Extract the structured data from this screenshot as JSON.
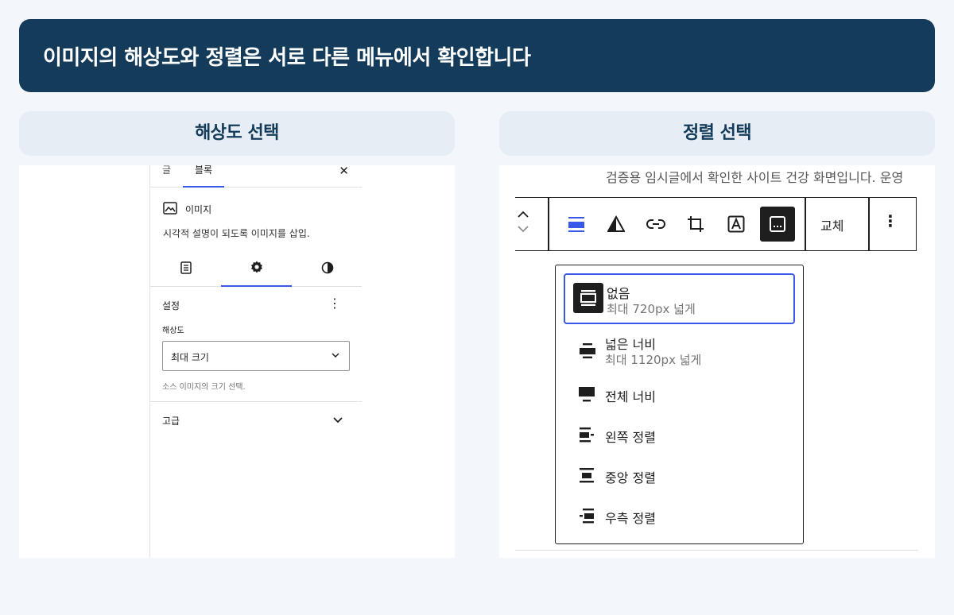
{
  "banner": {
    "title": "이미지의 해상도와 정렬은 서로 다른 메뉴에서 확인합니다"
  },
  "left": {
    "heading": "해상도 선택",
    "tabs": {
      "post": "글",
      "block": "블록",
      "close": "✕"
    },
    "block": {
      "name": "이미지",
      "description": "시각적 설명이 되도록 이미지를 삽입."
    },
    "settings": {
      "title": "설정",
      "more": "⋮",
      "resolution_label": "해상도",
      "resolution_value": "최대 크기",
      "resolution_help": "소스 이미지의 크기 선택."
    },
    "advanced": {
      "label": "고급"
    }
  },
  "right": {
    "heading": "정렬 선택",
    "preview_text": "검증용 임시글에서 확인한 사이트 건강 화면입니다. 운영",
    "toolbar": {
      "replace": "교체",
      "more": "⋮"
    },
    "align_options": [
      {
        "label": "없음",
        "sub": "최대 720px 넓게",
        "selected": true
      },
      {
        "label": "넓은 너비",
        "sub": "최대 1120px 넓게"
      },
      {
        "label": "전체 너비"
      },
      {
        "label": "왼쪽 정렬"
      },
      {
        "label": "중앙 정렬"
      },
      {
        "label": "우측 정렬"
      }
    ]
  },
  "colors": {
    "banner_bg": "#143b5a",
    "accent": "#3858e9",
    "pill_bg": "#e6edf4"
  }
}
